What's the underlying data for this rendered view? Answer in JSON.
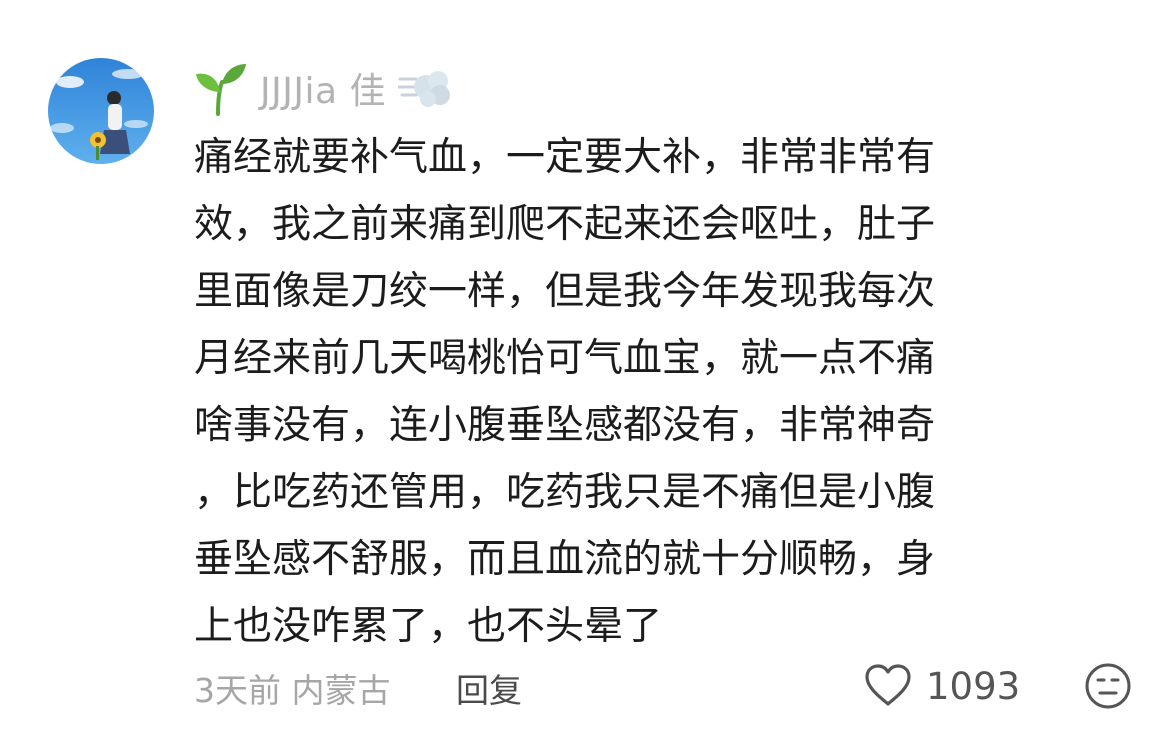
{
  "comment": {
    "author": {
      "name": "JJJJia 佳"
    },
    "body_lines": [
      "痛经就要补气血，一定要大补，非常非常有",
      "效，我之前来痛到爬不起来还会呕吐，肚子",
      "里面像是刀绞一样，但是我今年发现我每次",
      "月经来前几天喝桃怡可气血宝，就一点不痛",
      "啥事没有，连小腹垂坠感都没有，非常神奇",
      "，比吃药还管用，吃药我只是不痛但是小腹",
      "垂坠感不舒服，而且血流的就十分顺畅，身",
      "上也没咋累了，也不头晕了"
    ],
    "meta": "3天前 内蒙古",
    "reply_label": "回复",
    "like_count": "1093"
  },
  "icons": {
    "name_prefix": "sprout-icon",
    "name_suffix": "dash-cloud-icon",
    "like": "heart-outline-icon",
    "reaction": "neutral-face-icon"
  },
  "colors": {
    "username": "#b3b3b3",
    "body_text": "#1c1c1c",
    "meta_text": "#a6a6a6",
    "sprout_green": "#5aa83a"
  }
}
